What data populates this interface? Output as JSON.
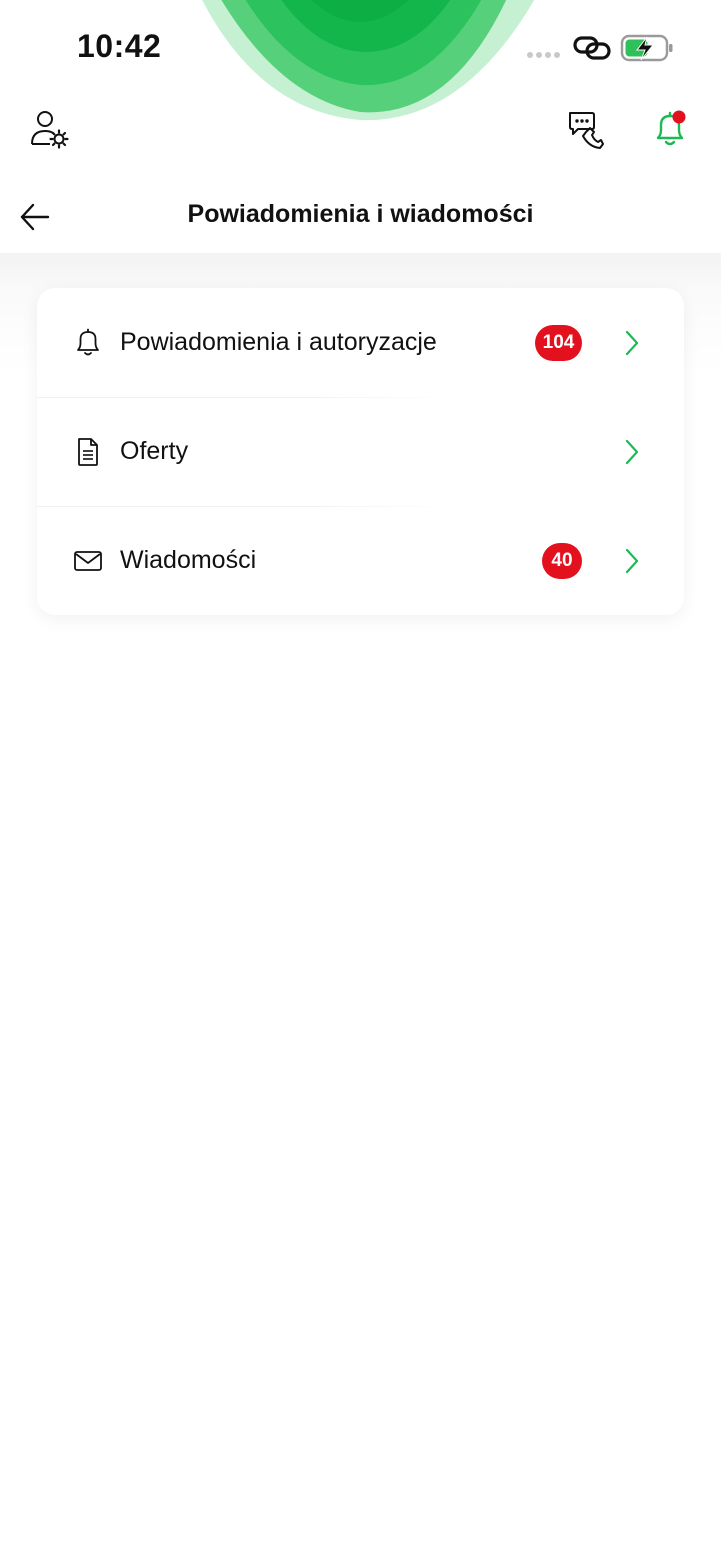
{
  "status_bar": {
    "time": "10:42"
  },
  "header": {
    "title": "Powiadomienia i wiadomości",
    "icons": {
      "left": "user-settings-icon",
      "right": [
        "chat-call-icon",
        "notification-bell-icon"
      ]
    }
  },
  "menu": {
    "items": [
      {
        "label": "Powiadomienia i autoryzacje",
        "icon": "bell-icon",
        "badge": "104"
      },
      {
        "label": "Oferty",
        "icon": "document-icon",
        "badge": null
      },
      {
        "label": "Wiadomości",
        "icon": "envelope-icon",
        "badge": "40"
      }
    ]
  },
  "colors": {
    "accent_green": "#1db954",
    "badge_red": "#e3101d",
    "text": "#111111"
  }
}
